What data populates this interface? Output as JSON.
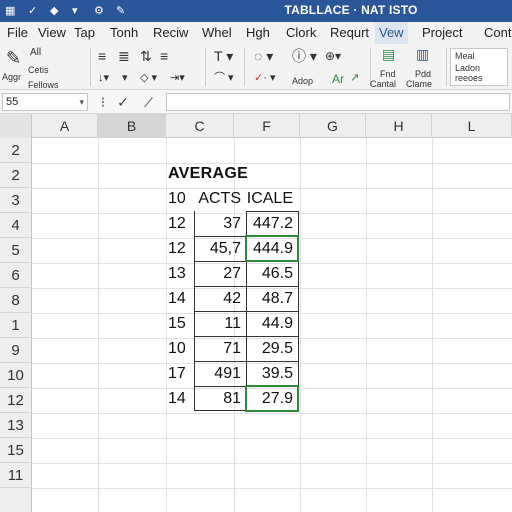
{
  "window": {
    "title": "TABLLACE · NAT ISTO",
    "quick_access": [
      "▦",
      "✓",
      "◆",
      "▾",
      "⚙",
      "✎"
    ]
  },
  "menu": {
    "tabs": [
      "File",
      "View",
      "Tap",
      "Tonh",
      "Reciw",
      "Whel",
      "Hgh",
      "Clork",
      "Requrt",
      "Vew",
      "Project",
      "Contu"
    ],
    "active": "Vew"
  },
  "ribbon": {
    "clipboard": [
      "All",
      "Cetis",
      "Fellows",
      "Aggr"
    ],
    "styles_a": "Adop",
    "styles_b": "Ar",
    "find": [
      "Fnd",
      "Cantal"
    ],
    "fill": [
      "Pdd",
      "Clame"
    ],
    "side_box": [
      "Meal",
      "Ladon",
      "reeoes"
    ]
  },
  "formula_bar": {
    "name_box": "55",
    "cancel_icon": "cancel-icon",
    "confirm_icon": "check-icon",
    "function_icon": "function-icon",
    "value": ""
  },
  "sheet": {
    "columns": [
      "A",
      "B",
      "C",
      "F",
      "G",
      "H",
      "L"
    ],
    "selected_column": "B",
    "rows": [
      "2",
      "2",
      "3",
      "4",
      "5",
      "6",
      "8",
      "1",
      "9",
      "10",
      "12",
      "13",
      "15",
      "11"
    ],
    "heading": "AVERAGE",
    "header_row": [
      "10",
      "ACTS",
      "ICALE"
    ],
    "data": [
      [
        "12",
        "37",
        "447.2"
      ],
      [
        "12",
        "45,7",
        "444.9"
      ],
      [
        "13",
        "27",
        "46.5"
      ],
      [
        "14",
        "42",
        "48.7"
      ],
      [
        "15",
        "11",
        "44.9"
      ],
      [
        "10",
        "71",
        "29.5"
      ],
      [
        "17",
        "491",
        "39.5"
      ],
      [
        "14",
        "81",
        "27.9"
      ]
    ]
  }
}
